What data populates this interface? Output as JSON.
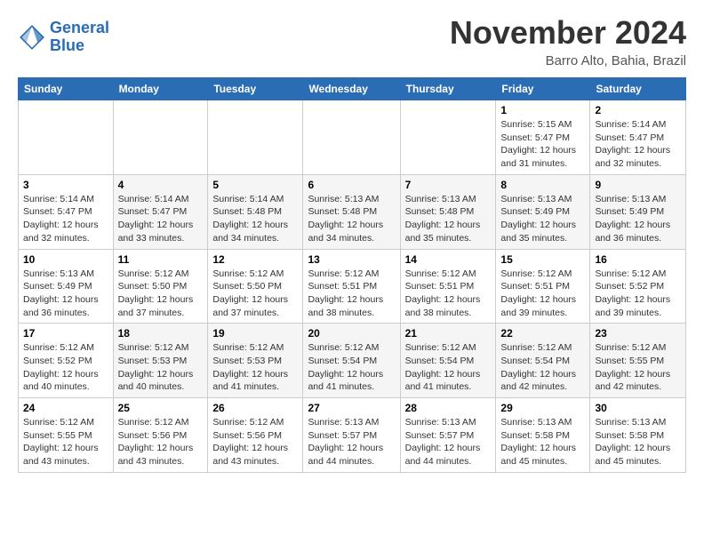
{
  "header": {
    "logo_line1": "General",
    "logo_line2": "Blue",
    "month_title": "November 2024",
    "location": "Barro Alto, Bahia, Brazil"
  },
  "days_of_week": [
    "Sunday",
    "Monday",
    "Tuesday",
    "Wednesday",
    "Thursday",
    "Friday",
    "Saturday"
  ],
  "weeks": [
    [
      {
        "day": "",
        "info": ""
      },
      {
        "day": "",
        "info": ""
      },
      {
        "day": "",
        "info": ""
      },
      {
        "day": "",
        "info": ""
      },
      {
        "day": "",
        "info": ""
      },
      {
        "day": "1",
        "info": "Sunrise: 5:15 AM\nSunset: 5:47 PM\nDaylight: 12 hours\nand 31 minutes."
      },
      {
        "day": "2",
        "info": "Sunrise: 5:14 AM\nSunset: 5:47 PM\nDaylight: 12 hours\nand 32 minutes."
      }
    ],
    [
      {
        "day": "3",
        "info": "Sunrise: 5:14 AM\nSunset: 5:47 PM\nDaylight: 12 hours\nand 32 minutes."
      },
      {
        "day": "4",
        "info": "Sunrise: 5:14 AM\nSunset: 5:47 PM\nDaylight: 12 hours\nand 33 minutes."
      },
      {
        "day": "5",
        "info": "Sunrise: 5:14 AM\nSunset: 5:48 PM\nDaylight: 12 hours\nand 34 minutes."
      },
      {
        "day": "6",
        "info": "Sunrise: 5:13 AM\nSunset: 5:48 PM\nDaylight: 12 hours\nand 34 minutes."
      },
      {
        "day": "7",
        "info": "Sunrise: 5:13 AM\nSunset: 5:48 PM\nDaylight: 12 hours\nand 35 minutes."
      },
      {
        "day": "8",
        "info": "Sunrise: 5:13 AM\nSunset: 5:49 PM\nDaylight: 12 hours\nand 35 minutes."
      },
      {
        "day": "9",
        "info": "Sunrise: 5:13 AM\nSunset: 5:49 PM\nDaylight: 12 hours\nand 36 minutes."
      }
    ],
    [
      {
        "day": "10",
        "info": "Sunrise: 5:13 AM\nSunset: 5:49 PM\nDaylight: 12 hours\nand 36 minutes."
      },
      {
        "day": "11",
        "info": "Sunrise: 5:12 AM\nSunset: 5:50 PM\nDaylight: 12 hours\nand 37 minutes."
      },
      {
        "day": "12",
        "info": "Sunrise: 5:12 AM\nSunset: 5:50 PM\nDaylight: 12 hours\nand 37 minutes."
      },
      {
        "day": "13",
        "info": "Sunrise: 5:12 AM\nSunset: 5:51 PM\nDaylight: 12 hours\nand 38 minutes."
      },
      {
        "day": "14",
        "info": "Sunrise: 5:12 AM\nSunset: 5:51 PM\nDaylight: 12 hours\nand 38 minutes."
      },
      {
        "day": "15",
        "info": "Sunrise: 5:12 AM\nSunset: 5:51 PM\nDaylight: 12 hours\nand 39 minutes."
      },
      {
        "day": "16",
        "info": "Sunrise: 5:12 AM\nSunset: 5:52 PM\nDaylight: 12 hours\nand 39 minutes."
      }
    ],
    [
      {
        "day": "17",
        "info": "Sunrise: 5:12 AM\nSunset: 5:52 PM\nDaylight: 12 hours\nand 40 minutes."
      },
      {
        "day": "18",
        "info": "Sunrise: 5:12 AM\nSunset: 5:53 PM\nDaylight: 12 hours\nand 40 minutes."
      },
      {
        "day": "19",
        "info": "Sunrise: 5:12 AM\nSunset: 5:53 PM\nDaylight: 12 hours\nand 41 minutes."
      },
      {
        "day": "20",
        "info": "Sunrise: 5:12 AM\nSunset: 5:54 PM\nDaylight: 12 hours\nand 41 minutes."
      },
      {
        "day": "21",
        "info": "Sunrise: 5:12 AM\nSunset: 5:54 PM\nDaylight: 12 hours\nand 41 minutes."
      },
      {
        "day": "22",
        "info": "Sunrise: 5:12 AM\nSunset: 5:54 PM\nDaylight: 12 hours\nand 42 minutes."
      },
      {
        "day": "23",
        "info": "Sunrise: 5:12 AM\nSunset: 5:55 PM\nDaylight: 12 hours\nand 42 minutes."
      }
    ],
    [
      {
        "day": "24",
        "info": "Sunrise: 5:12 AM\nSunset: 5:55 PM\nDaylight: 12 hours\nand 43 minutes."
      },
      {
        "day": "25",
        "info": "Sunrise: 5:12 AM\nSunset: 5:56 PM\nDaylight: 12 hours\nand 43 minutes."
      },
      {
        "day": "26",
        "info": "Sunrise: 5:12 AM\nSunset: 5:56 PM\nDaylight: 12 hours\nand 43 minutes."
      },
      {
        "day": "27",
        "info": "Sunrise: 5:13 AM\nSunset: 5:57 PM\nDaylight: 12 hours\nand 44 minutes."
      },
      {
        "day": "28",
        "info": "Sunrise: 5:13 AM\nSunset: 5:57 PM\nDaylight: 12 hours\nand 44 minutes."
      },
      {
        "day": "29",
        "info": "Sunrise: 5:13 AM\nSunset: 5:58 PM\nDaylight: 12 hours\nand 45 minutes."
      },
      {
        "day": "30",
        "info": "Sunrise: 5:13 AM\nSunset: 5:58 PM\nDaylight: 12 hours\nand 45 minutes."
      }
    ]
  ]
}
